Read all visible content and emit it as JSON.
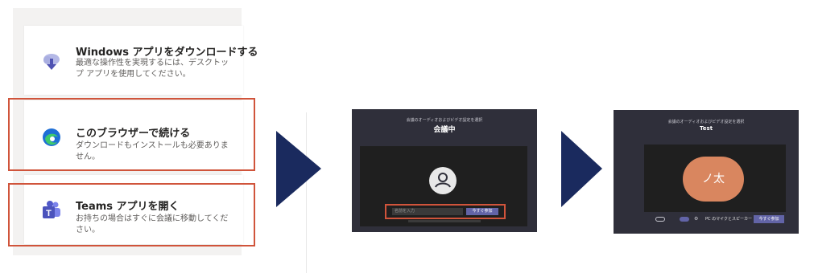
{
  "options": [
    {
      "title": "Windows アプリをダウンロードする",
      "desc": "最適な操作性を実現するには、デスクトップ アプリを使用してください。",
      "icon": "download-icon"
    },
    {
      "title": "このブラウザーで続ける",
      "desc": "ダウンロードもインストールも必要ありません。",
      "icon": "edge-browser-icon"
    },
    {
      "title": "Teams アプリを開く",
      "desc": "お持ちの場合はすぐに会議に移動してください。",
      "icon": "teams-icon"
    }
  ],
  "screen1": {
    "caption": "会議のオーディオおよびビデオ設定を選択",
    "meeting_name": "会議中",
    "name_placeholder": "名前を入力",
    "join_label": "今すぐ参加"
  },
  "screen2": {
    "caption": "会議のオーディオおよびビデオ設定を選択",
    "meeting_name": "Test",
    "avatar_initials": "ノ太",
    "audio_label": "PC のマイクとスピーカー",
    "join_label": "今すぐ参加"
  },
  "colors": {
    "highlight": "#d0543b",
    "arrow": "#1a2a5e",
    "teams_purple": "#6264a7",
    "avatar": "#d9865f"
  }
}
